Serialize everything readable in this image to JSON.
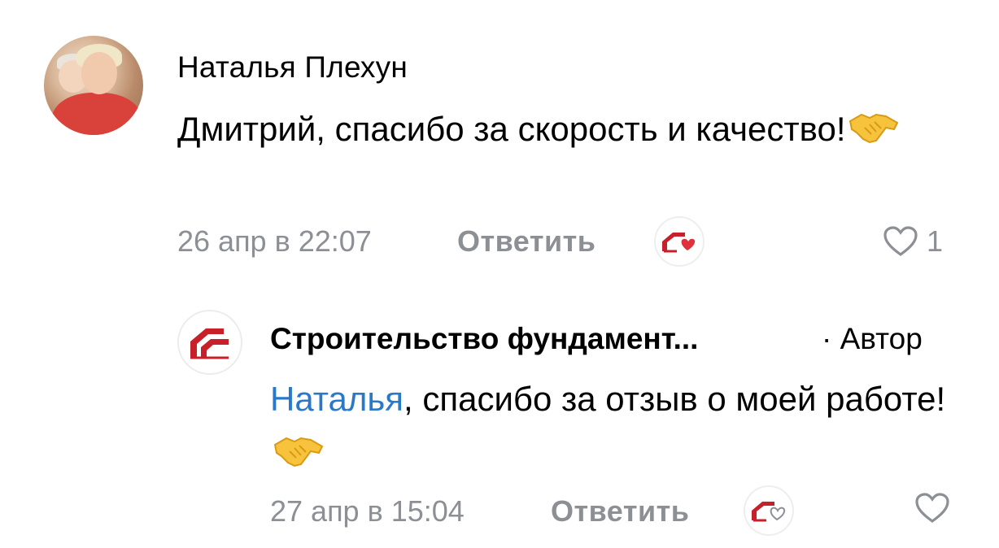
{
  "comments": [
    {
      "author": "Наталья Плехун",
      "text": "Дмитрий, спасибо за скорость и качество!",
      "emoji": "handshake-emoji",
      "date": "26 апр в 22:07",
      "reply_label": "Ответить",
      "likes": "1",
      "liked_by_author": true
    },
    {
      "author": "Строительство фундамент...",
      "author_badge": "· Автор",
      "mention": "Наталья",
      "text": ", спасибо за отзыв о моей работе!",
      "emoji": "handshake-emoji",
      "date": "27 апр в 15:04",
      "reply_label": "Ответить",
      "likes": "",
      "liked_by_author": false
    }
  ],
  "colors": {
    "brand": "#c8202a",
    "mention": "#2a79c9",
    "meta": "#8c8f94",
    "heart_filled": "#e0303b"
  }
}
